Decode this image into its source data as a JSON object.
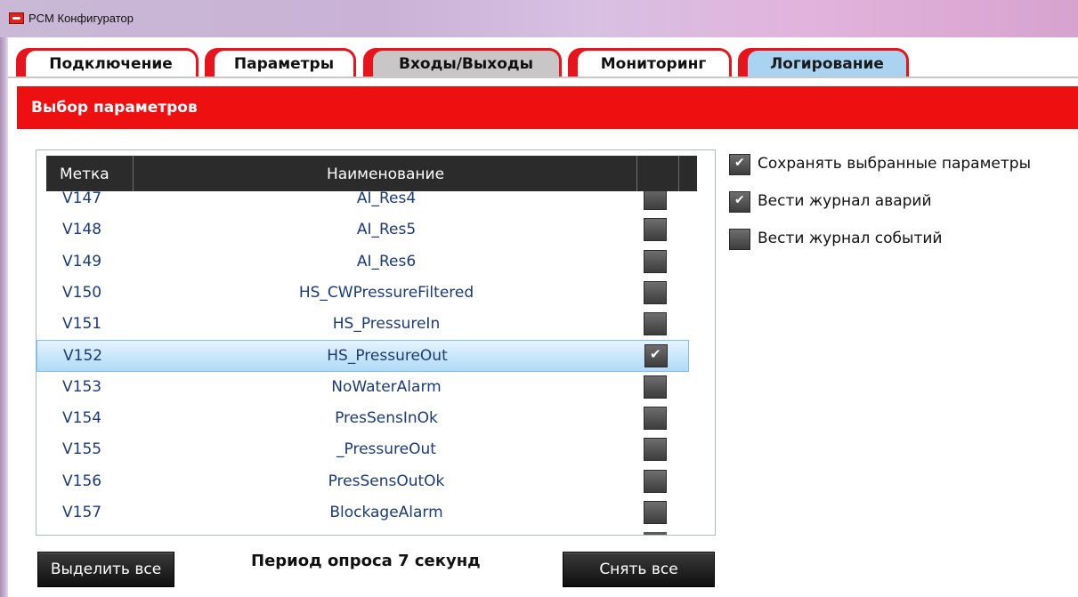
{
  "window": {
    "title": "PCM Конфигуратор"
  },
  "tabs": [
    {
      "label": "Подключение",
      "state": "normal"
    },
    {
      "label": "Параметры",
      "state": "normal"
    },
    {
      "label": "Входы/Выходы",
      "state": "gray"
    },
    {
      "label": "Мониторинг",
      "state": "normal"
    },
    {
      "label": "Логирование",
      "state": "active"
    }
  ],
  "section": {
    "title": "Выбор параметров"
  },
  "table": {
    "columns": {
      "label": "Метка",
      "name": "Наименование"
    },
    "rows": [
      {
        "label": "V147",
        "name": "AI_Res4",
        "checked": false,
        "selected": false
      },
      {
        "label": "V148",
        "name": "AI_Res5",
        "checked": false,
        "selected": false
      },
      {
        "label": "V149",
        "name": "AI_Res6",
        "checked": false,
        "selected": false
      },
      {
        "label": "V150",
        "name": "HS_CWPressureFiltered",
        "checked": false,
        "selected": false
      },
      {
        "label": "V151",
        "name": "HS_PressureIn",
        "checked": false,
        "selected": false
      },
      {
        "label": "V152",
        "name": "HS_PressureOut",
        "checked": true,
        "selected": true
      },
      {
        "label": "V153",
        "name": "NoWaterAlarm",
        "checked": false,
        "selected": false
      },
      {
        "label": "V154",
        "name": "PresSensInOk",
        "checked": false,
        "selected": false
      },
      {
        "label": "V155",
        "name": "_PressureOut",
        "checked": false,
        "selected": false
      },
      {
        "label": "V156",
        "name": "PresSensOutOk",
        "checked": false,
        "selected": false
      },
      {
        "label": "V157",
        "name": "BlockageAlarm",
        "checked": false,
        "selected": false
      }
    ]
  },
  "options": [
    {
      "label": "Сохранять выбранные параметры",
      "checked": true
    },
    {
      "label": "Вести журнал аварий",
      "checked": true
    },
    {
      "label": "Вести журнал событий",
      "checked": false
    }
  ],
  "bottom": {
    "select_all": "Выделить все",
    "period": "Период опроса 7 секунд",
    "clear_all": "Снять все"
  },
  "colors": {
    "accent_red": "#ee0f11",
    "active_tab": "#a9d3f1",
    "selected_row": "#c7e6fa",
    "text_blue": "#1a3a7a"
  }
}
